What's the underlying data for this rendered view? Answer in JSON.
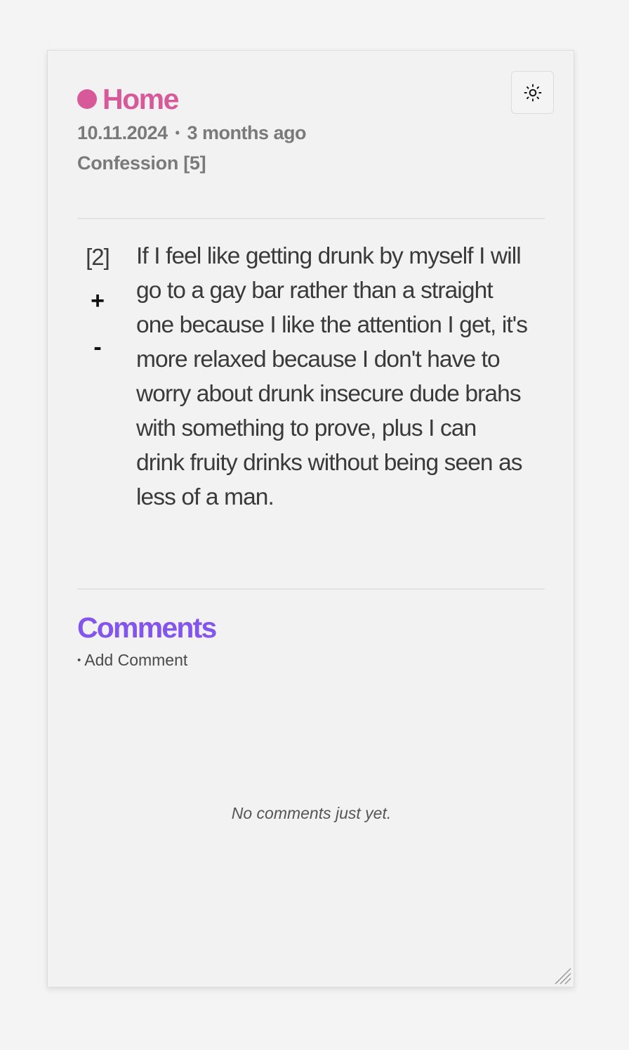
{
  "header": {
    "home_label": "Home",
    "accent_color": "#d8599a",
    "theme_toggle_icon": "sun-icon"
  },
  "post": {
    "date": "10.11.2024",
    "separator": "•",
    "relative_time": "3 months ago",
    "category": "Confession [5]",
    "score": "[2]",
    "upvote_label": "+",
    "downvote_label": "-",
    "text": "If I feel like getting drunk by myself I will go to a gay bar rather than a straight one because I like the attention I get, it's more relaxed because I don't have to worry about drunk insecure dude brahs with something to prove, plus I can drink fruity drinks without being seen as less of a man."
  },
  "comments": {
    "title": "Comments",
    "title_color": "#8455ec",
    "bullet": "•",
    "add_label": "Add Comment",
    "empty_message": "No comments just yet."
  }
}
